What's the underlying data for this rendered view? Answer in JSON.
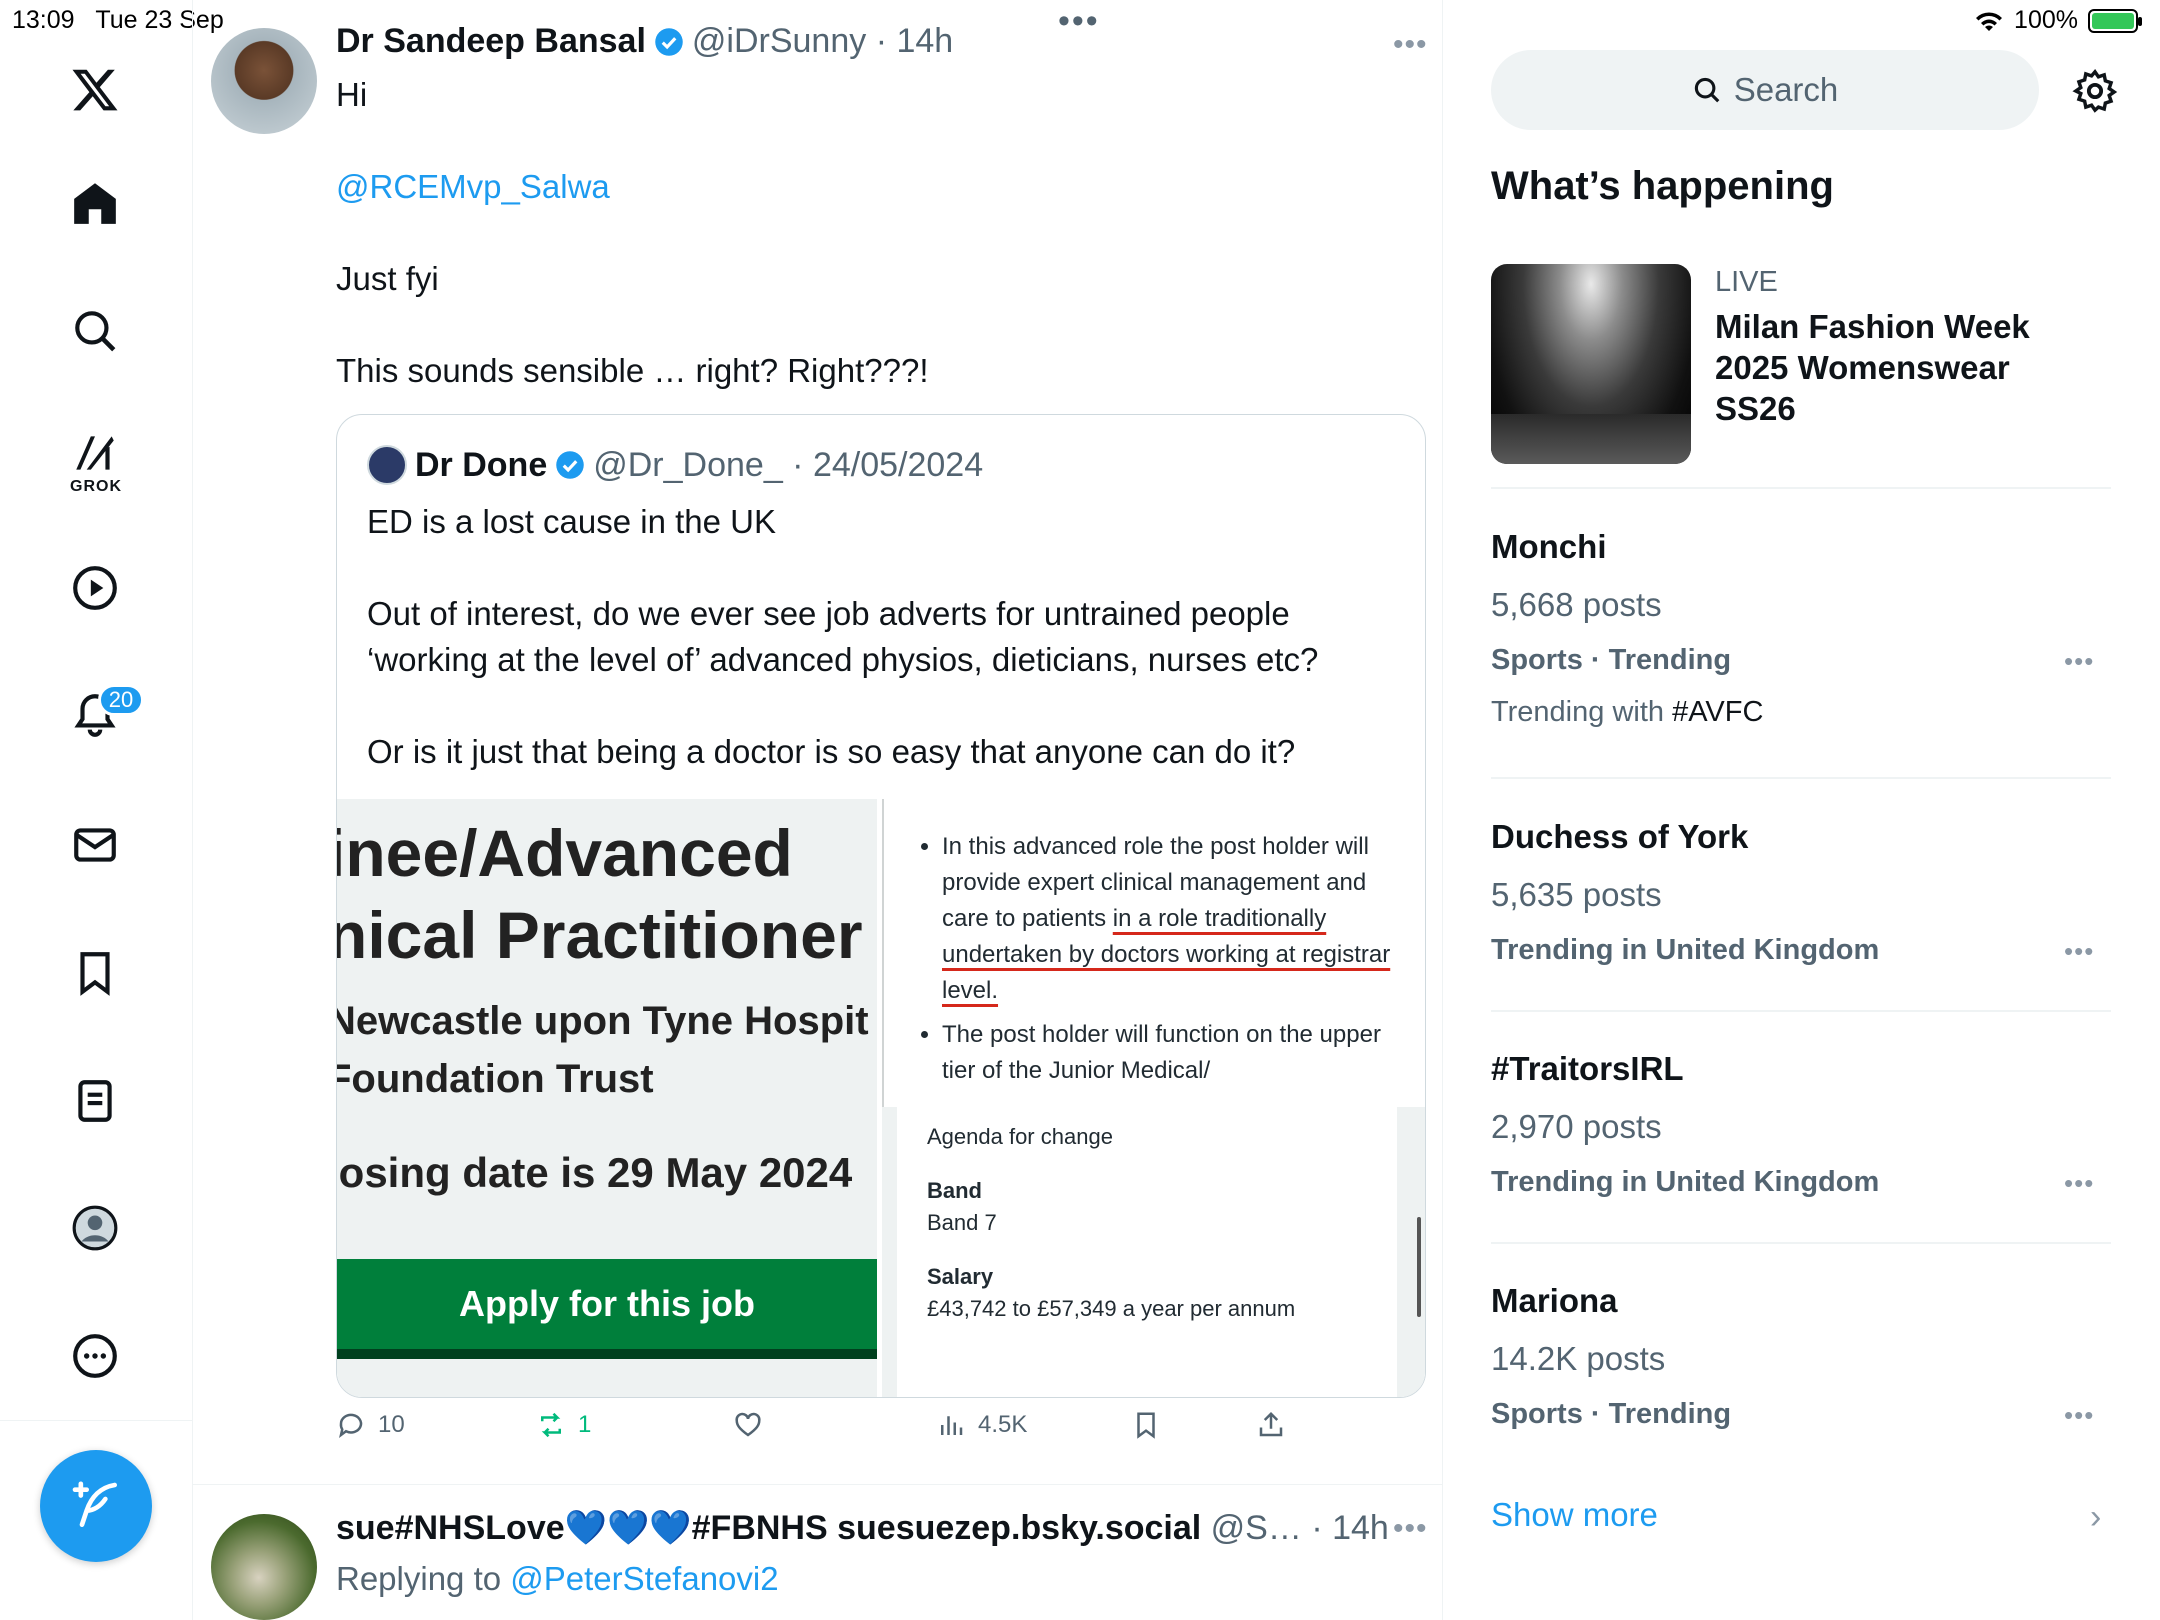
{
  "status_bar": {
    "time": "13:09",
    "date": "Tue 23 Sep",
    "battery": "100%",
    "battery_level": 1.0
  },
  "nav": {
    "grok_label": "GROK",
    "notifications_badge": "20",
    "icons": [
      "x-logo-icon",
      "home-icon",
      "search-icon",
      "grok-icon",
      "video-icon",
      "bell-icon",
      "mail-icon",
      "bookmark-icon",
      "lists-icon",
      "profile-icon",
      "more-icon",
      "compose-icon"
    ]
  },
  "post": {
    "author_name": "Dr Sandeep Bansal",
    "handle": "@iDrSunny",
    "time": "14h",
    "text": {
      "line1": "Hi",
      "mention": "@RCEMvp_Salwa",
      "line3": "Just fyi",
      "line4": "This sounds sensible … right? Right???!"
    },
    "quote": {
      "author_name": "Dr Done",
      "handle": "@Dr_Done_",
      "date": "24/05/2024",
      "p1": "ED is a lost cause in the UK",
      "p2": "Out of interest, do we ever see job adverts for untrained people ‘working at the level of’ advanced physios, dieticians, nurses etc?",
      "p3": "Or is it just that being a doctor is so easy that anyone can do it?",
      "media": {
        "title_line1": "inee/Advanced",
        "title_line2": "nical Practitioner",
        "org_line1": "Newcastle upon Tyne Hospit",
        "org_line2": "Foundation Trust",
        "closing": "losing date is 29 May 2024",
        "apply": "Apply for this job",
        "bullet1_a": "In this advanced role the post holder will provide expert clinical management and care to patients ",
        "bullet1_b": "in a role traditionally undertaken by doctors working at registrar level.",
        "bullet2": "The post holder will function on the upper tier of the Junior Medical/",
        "agenda": "Agenda for change",
        "band_label": "Band",
        "band_value": "Band 7",
        "salary_label": "Salary",
        "salary_value": "£43,742 to £57,349 a year per annum"
      }
    },
    "actions": {
      "replies": "10",
      "reposts": "1",
      "views": "4.5K"
    }
  },
  "next_post": {
    "author_name": "sue#NHSLove💙💙💙#FBNHS suesuezep.bsky.social",
    "handle": "@S…",
    "time": "14h",
    "replying_label": "Replying to ",
    "replying_handle": "@PeterStefanovi2"
  },
  "sidebar": {
    "search_placeholder": "Search",
    "section_title": "What’s happening",
    "live": {
      "label": "LIVE",
      "title": "Milan Fashion Week 2025 Womenswear SS26"
    },
    "trends": [
      {
        "name": "Monchi",
        "count": "5,668 posts",
        "context": "Sports · Trending",
        "with_label": "Trending with ",
        "with_tag": "#AVFC"
      },
      {
        "name": "Duchess of York",
        "count": "5,635 posts",
        "context": "Trending in United Kingdom"
      },
      {
        "name": "#TraitorsIRL",
        "count": "2,970 posts",
        "context": "Trending in United Kingdom"
      },
      {
        "name": "Mariona",
        "count": "14.2K posts",
        "context": "Sports · Trending"
      }
    ],
    "show_more": "Show more"
  },
  "colors": {
    "accent": "#1d9bf0",
    "text_primary": "#0f1419",
    "text_secondary": "#536471",
    "nhs_green": "#007f3b",
    "repost_green": "#00ba7c",
    "underline_red": "#d5281b"
  }
}
